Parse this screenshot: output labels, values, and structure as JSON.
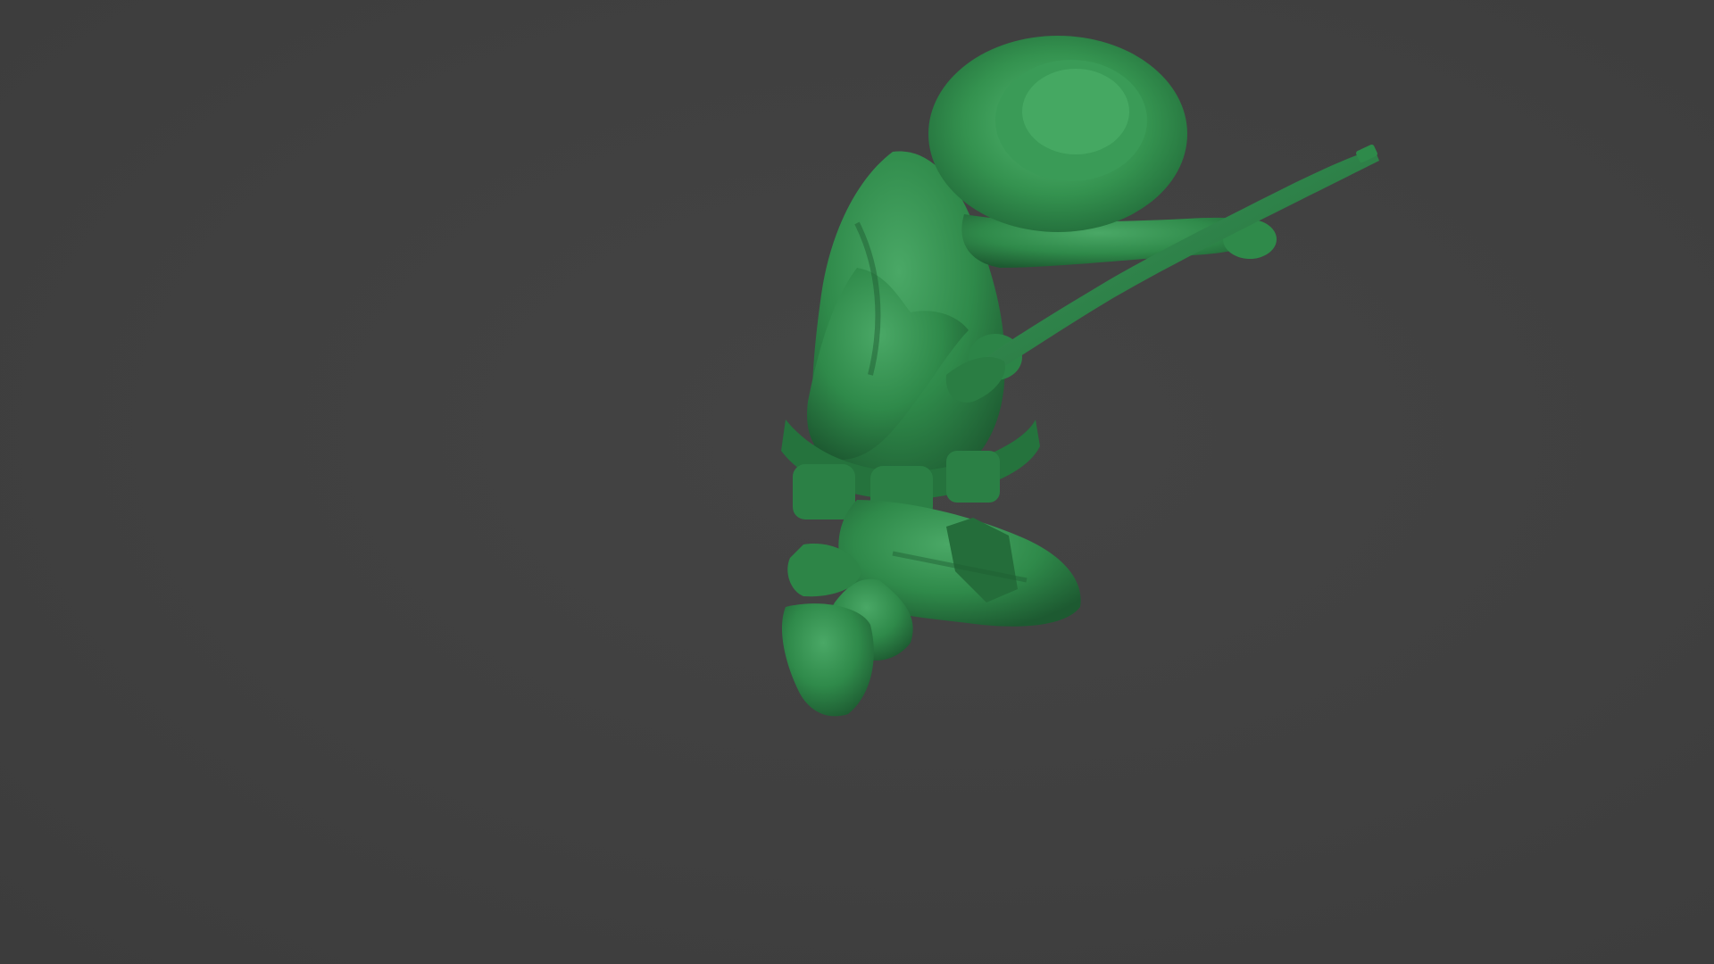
{
  "scene": {
    "subject": "soldier-figure",
    "background_color": "#404040",
    "figure_color": "#2f8a4a",
    "figure_shadow_color": "#1f5e33",
    "figure_highlight_color": "#4fb26c"
  }
}
